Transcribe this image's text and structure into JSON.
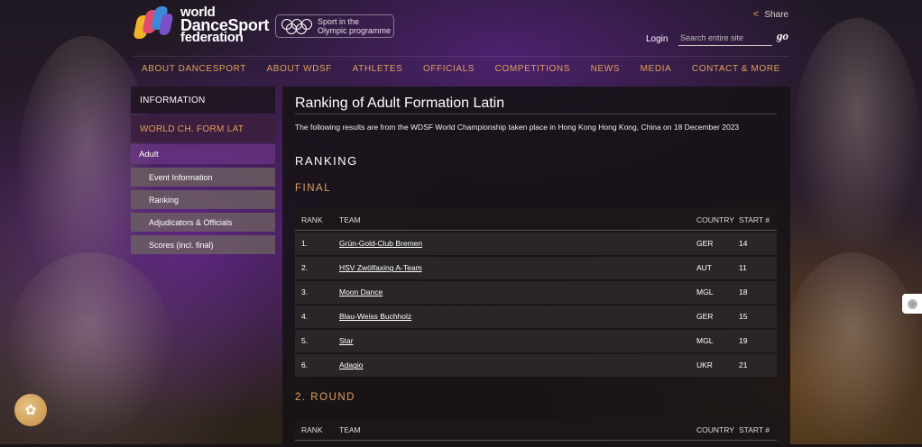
{
  "header": {
    "logo_line1": "world",
    "logo_line2": "DanceSport",
    "logo_line3": "federation",
    "olympic_line1": "Sport in the",
    "olympic_line2": "Olympic programme",
    "share_label": "Share",
    "login_label": "Login",
    "search_placeholder": "Search entire site",
    "go_label": "go"
  },
  "nav": [
    "ABOUT DANCESPORT",
    "ABOUT WDSF",
    "ATHLETES",
    "OFFICIALS",
    "COMPETITIONS",
    "NEWS",
    "MEDIA",
    "CONTACT & MORE"
  ],
  "sidebar": {
    "information": "INFORMATION",
    "active": "WORLD CH. FORM LAT",
    "sub": "Adult",
    "items": [
      "Event Information",
      "Ranking",
      "Adjudicators & Officials",
      "Scores (incl. final)"
    ]
  },
  "main": {
    "title": "Ranking of Adult Formation Latin",
    "intro": "The following results are from the WDSF World Championship taken place in Hong Kong Hong Kong, China on 18 December 2023",
    "ranking_heading": "RANKING",
    "final_heading": "FINAL",
    "round_heading": "2. ROUND",
    "columns": {
      "rank": "RANK",
      "team": "TEAM",
      "country": "COUNTRY",
      "start": "START #"
    },
    "final_rows": [
      {
        "rank": "1.",
        "team": "Grün-Gold-Club Bremen",
        "country": "GER",
        "start": "14"
      },
      {
        "rank": "2.",
        "team": "HSV Zwölfaxing A-Team",
        "country": "AUT",
        "start": "11"
      },
      {
        "rank": "3.",
        "team": "Moon Dance",
        "country": "MGL",
        "start": "18"
      },
      {
        "rank": "4.",
        "team": "Blau-Weiss Buchholz",
        "country": "GER",
        "start": "15"
      },
      {
        "rank": "5.",
        "team": "Star",
        "country": "MGL",
        "start": "19"
      },
      {
        "rank": "6.",
        "team": "Adagio",
        "country": "UKR",
        "start": "21"
      }
    ]
  },
  "colors": {
    "accent": "#e0a05c",
    "panel": "#2a2628"
  }
}
